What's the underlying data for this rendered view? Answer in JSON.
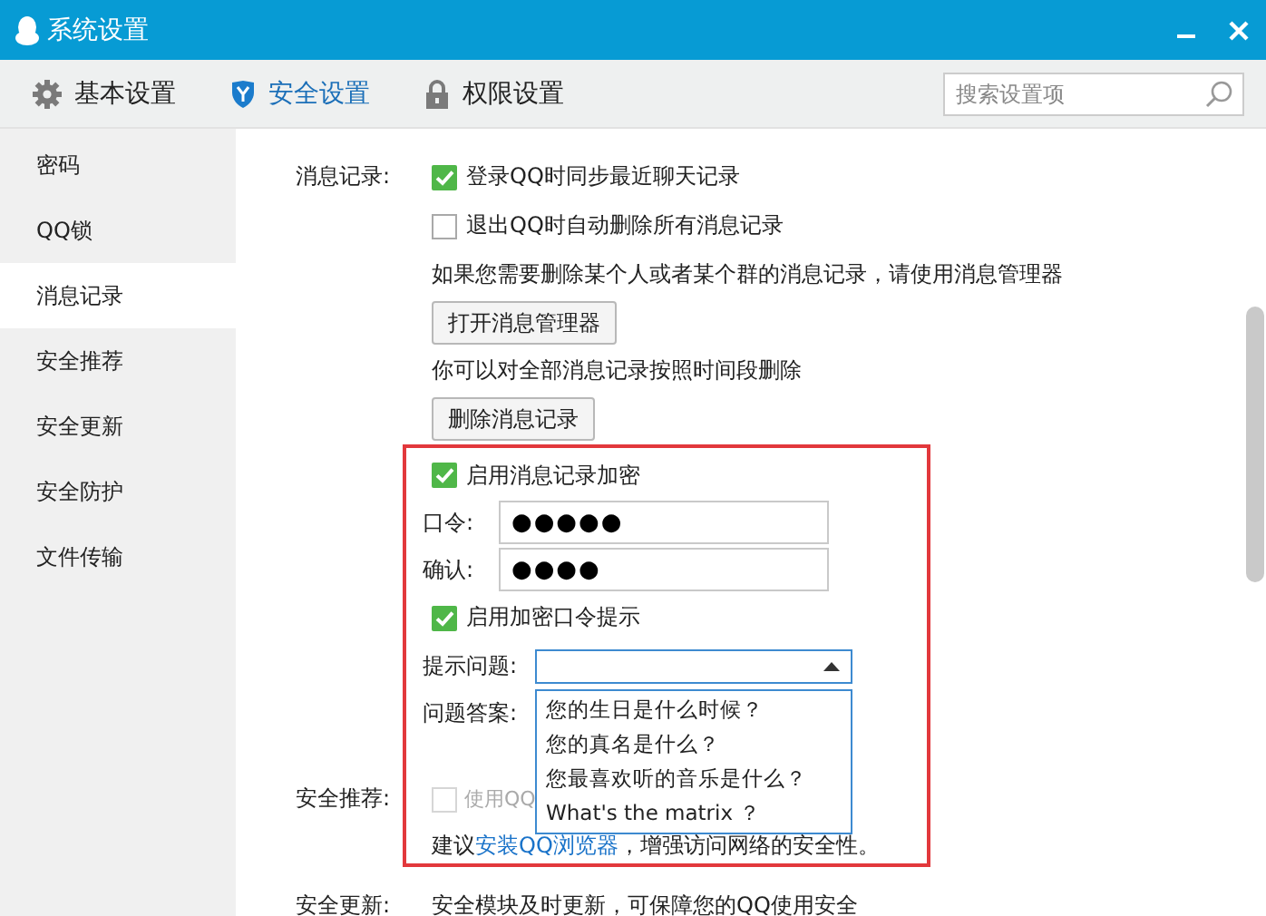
{
  "window": {
    "title": "系统设置"
  },
  "toolbar_tabs": [
    {
      "label": "基本设置",
      "kind": "gear",
      "selected": false
    },
    {
      "label": "安全设置",
      "kind": "shield",
      "selected": true
    },
    {
      "label": "权限设置",
      "kind": "lock",
      "selected": false
    }
  ],
  "search": {
    "placeholder": "搜索设置项"
  },
  "sidebar": {
    "items": [
      {
        "label": "密码",
        "selected": false
      },
      {
        "label": "QQ锁",
        "selected": false
      },
      {
        "label": "消息记录",
        "selected": true
      },
      {
        "label": "安全推荐",
        "selected": false
      },
      {
        "label": "安全更新",
        "selected": false
      },
      {
        "label": "安全防护",
        "selected": false
      },
      {
        "label": "文件传输",
        "selected": false
      }
    ]
  },
  "message_records": {
    "label": "消息记录:",
    "options": [
      {
        "label": "登录QQ时同步最近聊天记录",
        "checked": true
      },
      {
        "label": "退出QQ时自动删除所有消息记录",
        "checked": false
      }
    ],
    "manager_hint": "如果您需要删除某个人或者某个群的消息记录，请使用消息管理器",
    "manager_button": "打开消息管理器",
    "delete_hint": "你可以对全部消息记录按照时间段删除",
    "delete_button": "删除消息记录",
    "encryption": {
      "label": "启用消息记录加密",
      "checked": true
    },
    "password": {
      "label": "口令:",
      "value": "●●●●●"
    },
    "confirm": {
      "label": "确认:",
      "value": "●●●●"
    },
    "hint_enabled": {
      "label": "启用加密口令提示",
      "checked": true
    },
    "question": {
      "label": "提示问题:",
      "expanded": true,
      "options": [
        "您的生日是什么时候？",
        "您的真名是什么？",
        "您最喜欢听的音乐是什么？",
        "What's the matrix ？"
      ]
    },
    "answer": {
      "label": "问题答案:"
    }
  },
  "security_recommend": {
    "label": "安全推荐:",
    "option": {
      "label": "使用QQ",
      "checked": false,
      "disabled": true
    },
    "suggestion_before": "建议",
    "link": "安装QQ浏览器",
    "suggestion_after": "，增强访问网络的安全性。"
  },
  "security_update": {
    "label": "安全更新:",
    "text": "安全模块及时更新，可保障您的QQ使用安全"
  }
}
